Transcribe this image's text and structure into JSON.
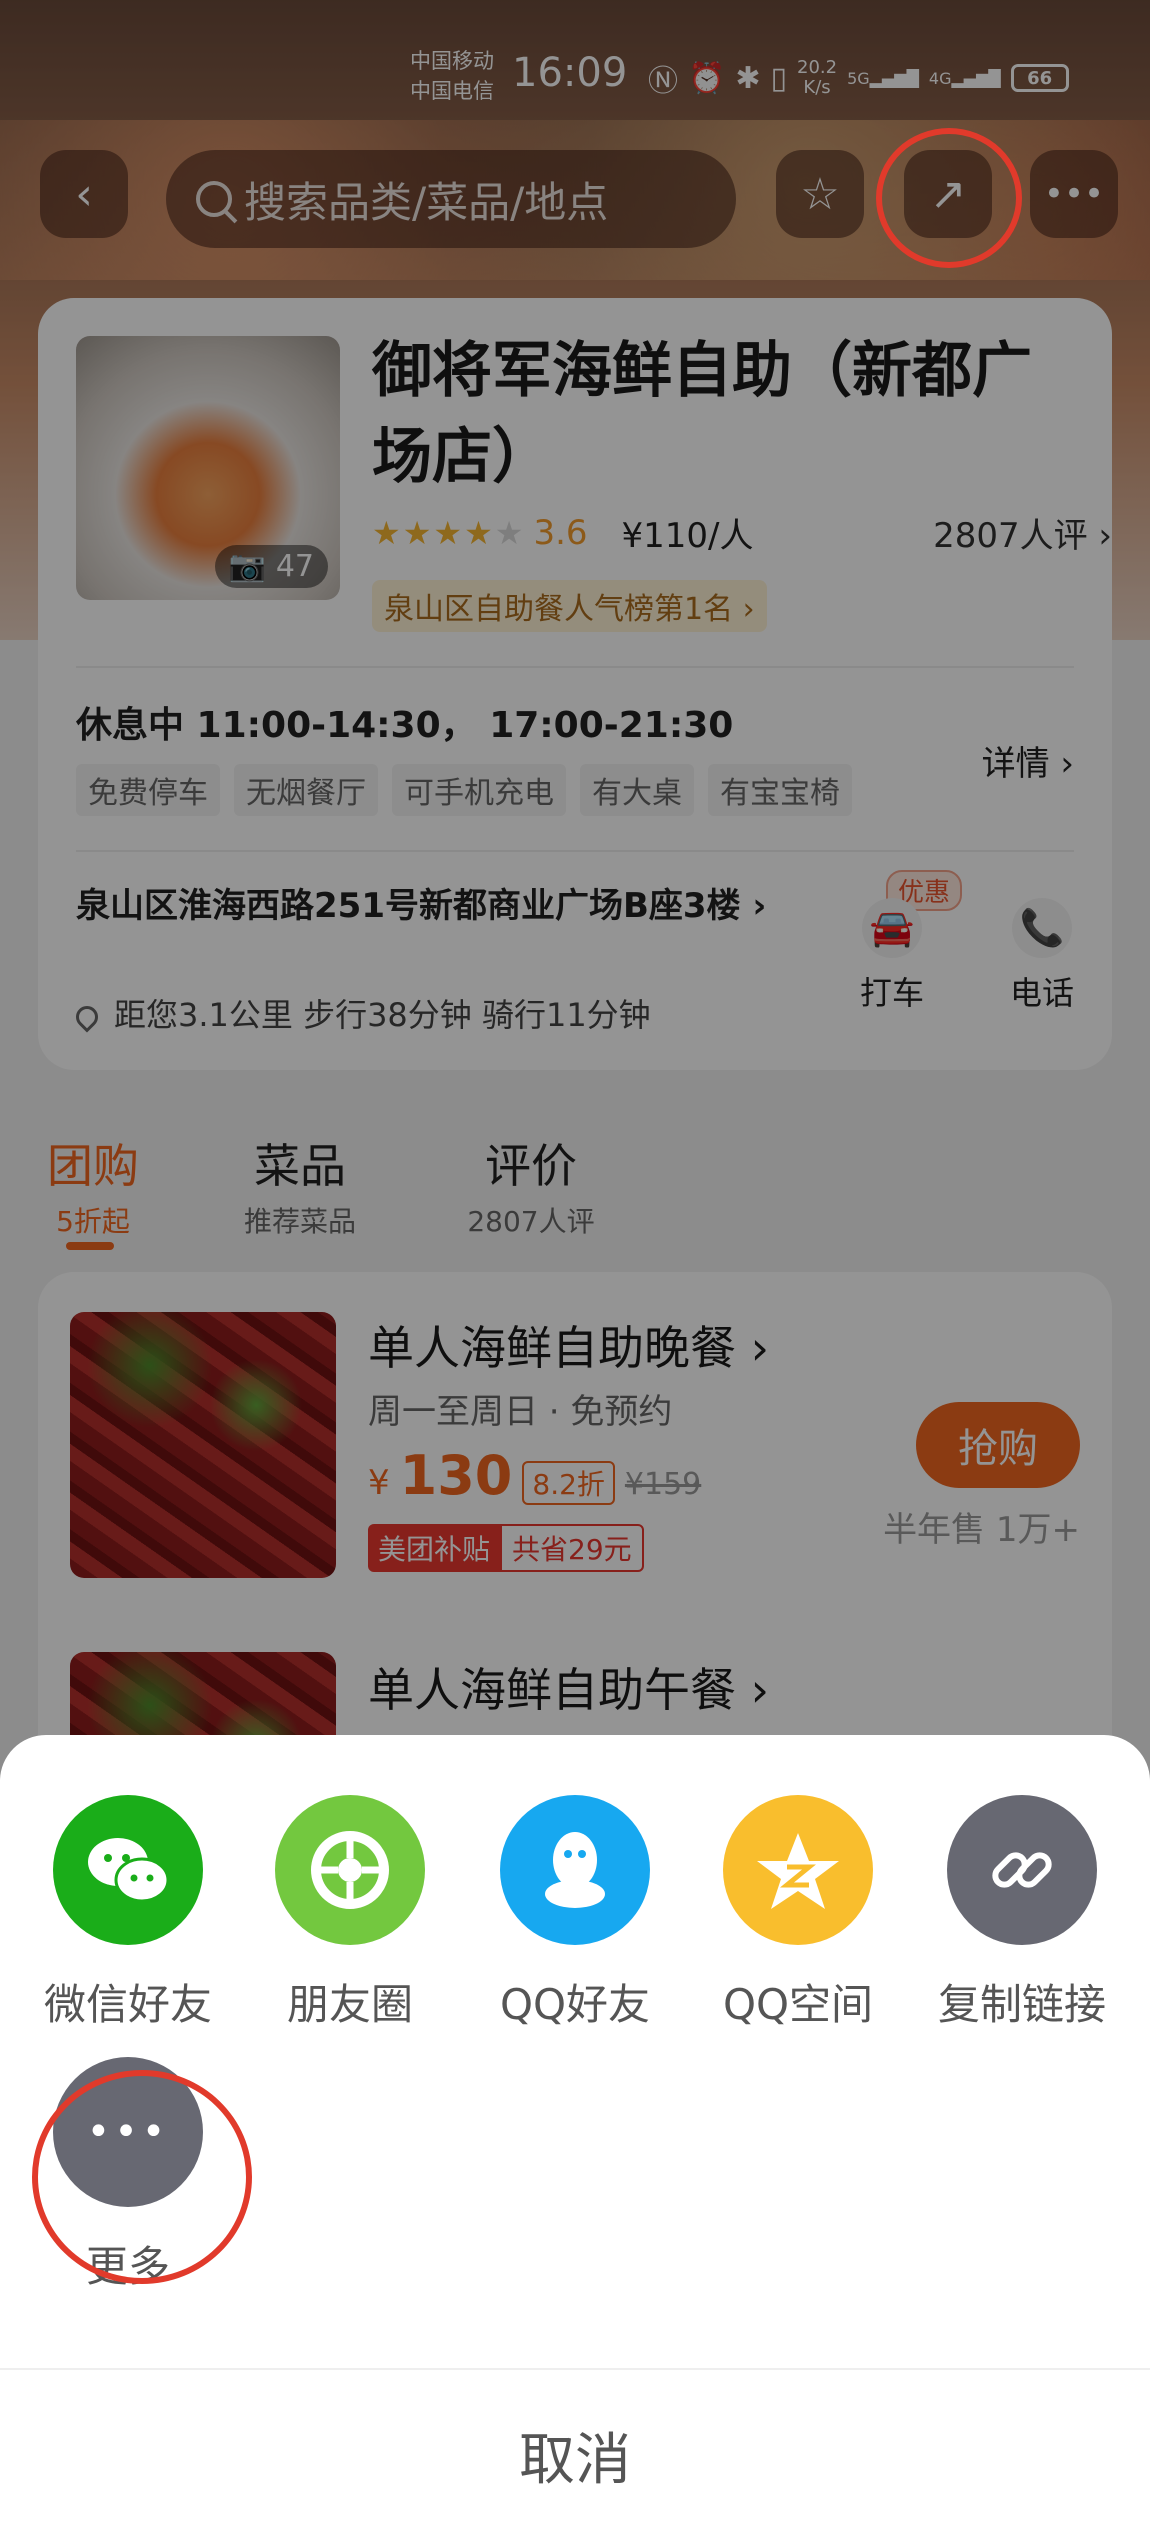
{
  "status_bar": {
    "carrier_1": "中国移动",
    "carrier_2": "中国电信",
    "time": "16:09",
    "net_speed_value": "20.2",
    "net_speed_unit": "K/s",
    "sig1": "5G",
    "sig2": "4G",
    "battery": "66"
  },
  "nav": {
    "search_placeholder": "搜索品类/菜品/地点"
  },
  "shop": {
    "title": "御将军海鲜自助（新都广场店）",
    "photo_count": "47",
    "rating": "3.6",
    "rating_value": 3.6,
    "price_per_person": "¥110/人",
    "review_count": "2807人评",
    "rank": "泉山区自助餐人气榜第1名",
    "hours": "休息中 11:00-14:30， 17:00-21:30",
    "details_label": "详情",
    "tags": [
      "免费停车",
      "无烟餐厅",
      "可手机充电",
      "有大桌",
      "有宝宝椅"
    ],
    "address": "泉山区淮海西路251号新都商业广场B座3楼",
    "distance": "距您3.1公里 步行38分钟 骑行11分钟",
    "taxi_promo": "优惠",
    "taxi_label": "打车",
    "phone_label": "电话"
  },
  "tabs": [
    {
      "label": "团购",
      "sub": "5折起",
      "active": true
    },
    {
      "label": "菜品",
      "sub": "推荐菜品",
      "active": false
    },
    {
      "label": "评价",
      "sub": "2807人评",
      "active": false
    }
  ],
  "deals": [
    {
      "title": "单人海鲜自助晚餐",
      "sub": "周一至周日 · 免预约",
      "currency": "¥",
      "price": "130",
      "discount": "8.2折",
      "original_price": "¥159",
      "badge_1": "美团补贴",
      "badge_2": "共省29元",
      "buy_label": "抢购",
      "sold": "半年售 1万+"
    },
    {
      "title": "单人海鲜自助午餐"
    }
  ],
  "share": {
    "items": [
      {
        "label": "微信好友",
        "icon": "wechat-icon",
        "color": "#1aad19"
      },
      {
        "label": "朋友圈",
        "icon": "moments-icon",
        "color": "#73c83f"
      },
      {
        "label": "QQ好友",
        "icon": "qq-icon",
        "color": "#17a8f0"
      },
      {
        "label": "QQ空间",
        "icon": "qzone-icon",
        "color": "#f9be2d"
      },
      {
        "label": "复制链接",
        "icon": "link-icon",
        "color": "#676872"
      },
      {
        "label": "更多",
        "icon": "more-icon",
        "color": "#676872"
      }
    ],
    "cancel_label": "取消"
  },
  "colors": {
    "accent": "#f0661f",
    "highlight_ring": "#e13a2b"
  }
}
